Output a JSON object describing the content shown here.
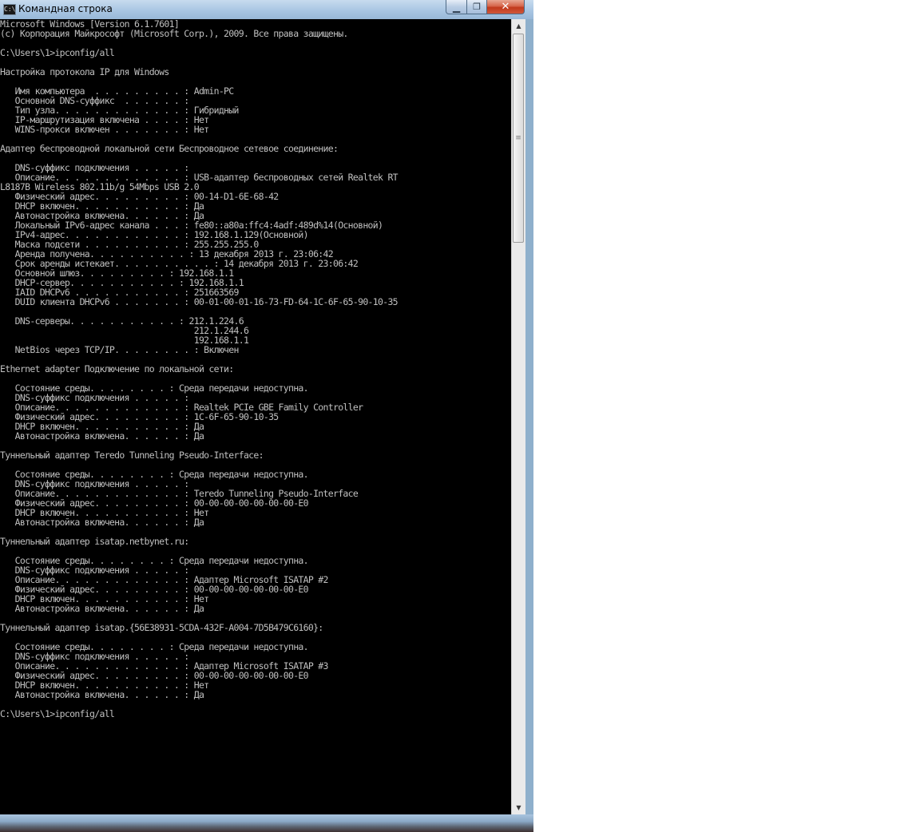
{
  "window": {
    "title": "Командная строка",
    "icon": "cmd-icon",
    "buttons": {
      "minimize": "minimize-icon",
      "maximize": "maximize-icon",
      "close": "close-icon"
    }
  },
  "console": {
    "lines": [
      "Microsoft Windows [Version 6.1.7601]",
      "(c) Корпорация Майкрософт (Microsoft Corp.), 2009. Все права защищены.",
      "",
      "C:\\Users\\1>ipconfig/all",
      "",
      "Настройка протокола IP для Windows",
      "",
      "   Имя компьютера  . . . . . . . . . : Admin-PC",
      "   Основной DNS-суффикс  . . . . . . :",
      "   Тип узла. . . . . . . . . . . . . : Гибридный",
      "   IP-маршрутизация включена . . . . : Нет",
      "   WINS-прокси включен . . . . . . . : Нет",
      "",
      "Адаптер беспроводной локальной сети Беспроводное сетевое соединение:",
      "",
      "   DNS-суффикс подключения . . . . . :",
      "   Описание. . . . . . . . . . . . . : USB-адаптер беспроводных сетей Realtek RT",
      "L8187B Wireless 802.11b/g 54Mbps USB 2.0",
      "   Физический адрес. . . . . . . . . : 00-14-D1-6E-68-42",
      "   DHCP включен. . . . . . . . . . . : Да",
      "   Автонастройка включена. . . . . . : Да",
      "   Локальный IPv6-адрес канала . . . : fe80::a80a:ffc4:4adf:489d%14(Основной)",
      "   IPv4-адрес. . . . . . . . . . . . : 192.168.1.129(Основной)",
      "   Маска подсети . . . . . . . . . . : 255.255.255.0",
      "   Аренда получена. . . . . . . . . . : 13 декабря 2013 г. 23:06:42",
      "   Срок аренды истекает. . . . . . . . . . : 14 декабря 2013 г. 23:06:42",
      "   Основной шлюз. . . . . . . . . : 192.168.1.1",
      "   DHCP-сервер. . . . . . . . . . . : 192.168.1.1",
      "   IAID DHCPv6 . . . . . . . . . . . : 251663569",
      "   DUID клиента DHCPv6 . . . . . . . : 00-01-00-01-16-73-FD-64-1C-6F-65-90-10-35",
      "",
      "   DNS-серверы. . . . . . . . . . . : 212.1.224.6",
      "                                       212.1.244.6",
      "                                       192.168.1.1",
      "   NetBios через TCP/IP. . . . . . . . : Включен",
      "",
      "Ethernet adapter Подключение по локальной сети:",
      "",
      "   Состояние среды. . . . . . . . : Среда передачи недоступна.",
      "   DNS-суффикс подключения . . . . . :",
      "   Описание. . . . . . . . . . . . . : Realtek PCIe GBE Family Controller",
      "   Физический адрес. . . . . . . . . : 1C-6F-65-90-10-35",
      "   DHCP включен. . . . . . . . . . . : Да",
      "   Автонастройка включена. . . . . . : Да",
      "",
      "Туннельный адаптер Teredo Tunneling Pseudo-Interface:",
      "",
      "   Состояние среды. . . . . . . . : Среда передачи недоступна.",
      "   DNS-суффикс подключения . . . . . :",
      "   Описание. . . . . . . . . . . . . : Teredo Tunneling Pseudo-Interface",
      "   Физический адрес. . . . . . . . . : 00-00-00-00-00-00-00-E0",
      "   DHCP включен. . . . . . . . . . . : Нет",
      "   Автонастройка включена. . . . . . : Да",
      "",
      "Туннельный адаптер isatap.netbynet.ru:",
      "",
      "   Состояние среды. . . . . . . . : Среда передачи недоступна.",
      "   DNS-суффикс подключения . . . . . :",
      "   Описание. . . . . . . . . . . . . : Адаптер Microsoft ISATAP #2",
      "   Физический адрес. . . . . . . . . : 00-00-00-00-00-00-00-E0",
      "   DHCP включен. . . . . . . . . . . : Нет",
      "   Автонастройка включена. . . . . . : Да",
      "",
      "Туннельный адаптер isatap.{56E38931-5CDA-432F-A004-7D5B479C6160}:",
      "",
      "   Состояние среды. . . . . . . . : Среда передачи недоступна.",
      "   DNS-суффикс подключения . . . . . :",
      "   Описание. . . . . . . . . . . . . : Адаптер Microsoft ISATAP #3",
      "   Физический адрес. . . . . . . . . : 00-00-00-00-00-00-00-E0",
      "   DHCP включен. . . . . . . . . . . : Нет",
      "   Автонастройка включена. . . . . . : Да",
      "",
      "C:\\Users\\1>ipconfig/all"
    ]
  },
  "scrollbar": {
    "up_icon": "scroll-up-icon",
    "down_icon": "scroll-down-icon",
    "grip_icon": "scroll-grip-icon"
  }
}
